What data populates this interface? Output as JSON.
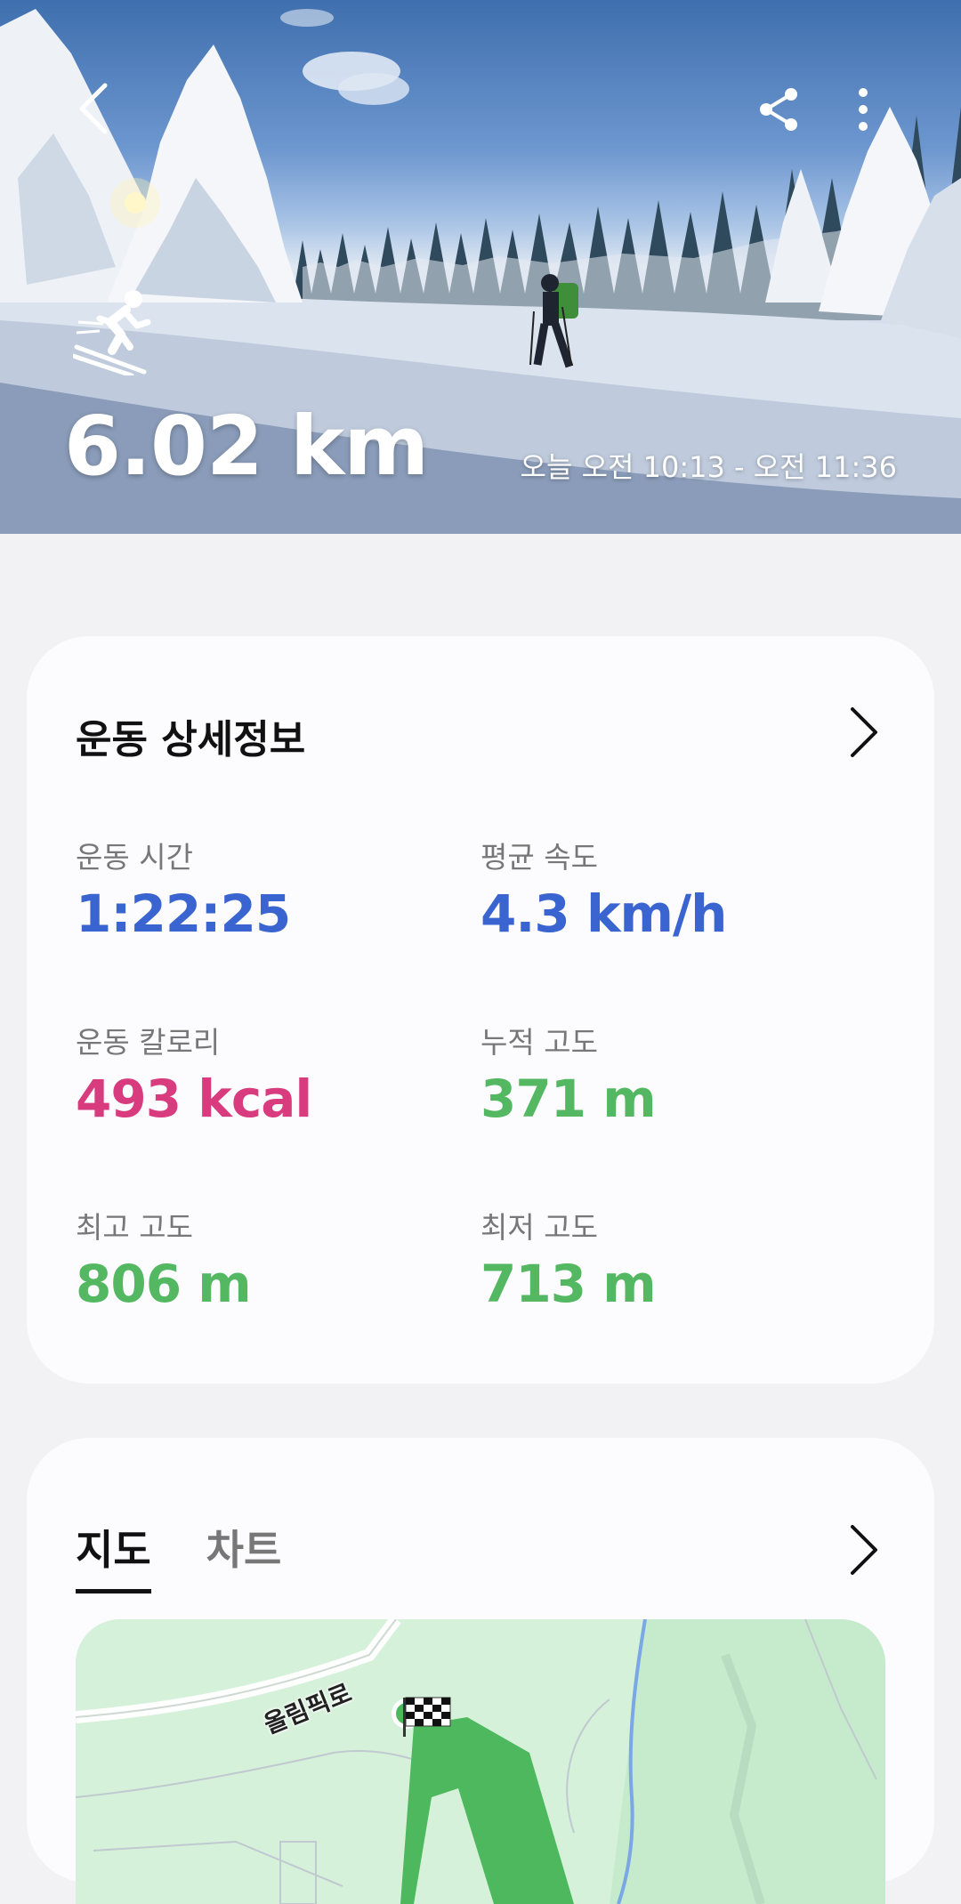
{
  "header": {
    "distance": "6.02 km",
    "time_range": "오늘 오전 10:13 - 오전 11:36"
  },
  "details": {
    "title": "운동 상세정보",
    "stats": [
      {
        "label": "운동 시간",
        "value": "1:22:25",
        "color": "#3a64cf"
      },
      {
        "label": "평균 속도",
        "value": "4.3 km/h",
        "color": "#3a64cf"
      },
      {
        "label": "운동 칼로리",
        "value": "493 kcal",
        "color": "#d83c7f"
      },
      {
        "label": "누적 고도",
        "value": "371 m",
        "color": "#54b862"
      },
      {
        "label": "최고 고도",
        "value": "806 m",
        "color": "#54b862"
      },
      {
        "label": "최저 고도",
        "value": "713 m",
        "color": "#54b862"
      }
    ]
  },
  "map_section": {
    "tabs": [
      {
        "label": "지도",
        "active": true
      },
      {
        "label": "차트",
        "active": false
      }
    ],
    "road_label": "올림픽로"
  },
  "icons": [
    "back-icon",
    "share-icon",
    "more-vert-icon",
    "skiing-icon",
    "chevron-right-icon",
    "finish-flag-icon",
    "start-marker-icon"
  ]
}
